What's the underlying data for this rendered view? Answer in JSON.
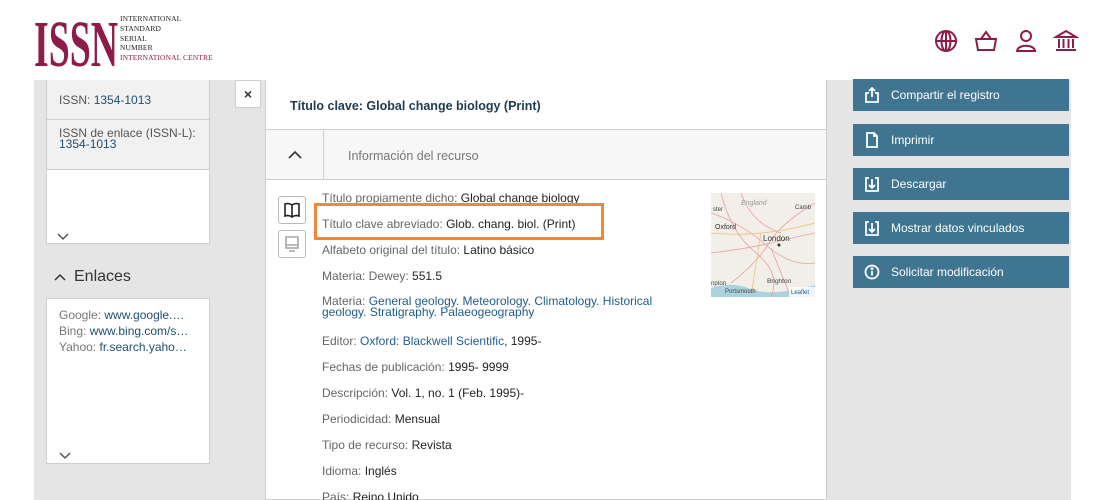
{
  "header": {
    "logo_letters": "ISSN",
    "logo_lines": [
      "INTERNATIONAL",
      "STANDARD",
      "SERIAL",
      "NUMBER",
      "INTERNATIONAL CENTRE"
    ],
    "brand_color": "#8d1c4a",
    "icons": [
      "globe-icon",
      "basket-icon",
      "user-icon",
      "institution-icon"
    ]
  },
  "left": {
    "issn_label": "ISSN: ",
    "issn_value": "1354-1013",
    "issnl_label": "ISSN de enlace (ISSN-L): ",
    "issnl_value": "1354-1013",
    "enlaces_title": "Enlaces",
    "links": [
      {
        "label": "Google: ",
        "value": "www.google.…"
      },
      {
        "label": "Bing: ",
        "value": "www.bing.com/s…"
      },
      {
        "label": "Yahoo: ",
        "value": "fr.search.yaho…"
      }
    ]
  },
  "main": {
    "close": "×",
    "key_title": "Título clave: Global change biology (Print)",
    "section_label": "Información del recurso",
    "fields": [
      {
        "label": "Título propiamente dicho: ",
        "value": "Global change biology"
      },
      {
        "label": "Título clave abreviado: ",
        "value": "Glob. chang. biol. (Print)"
      },
      {
        "label": "Alfabeto original del título: ",
        "value": "Latino básico"
      },
      {
        "label": "Materia: Dewey: ",
        "value": "551.5"
      },
      {
        "label": "Materia: ",
        "links": "General geology. Meteorology. Climatology. Historical geology. Stratigraphy. Palaeogeography"
      },
      {
        "label": "Editor: ",
        "links": "Oxford: Blackwell Scientific",
        "value": ", 1995-"
      },
      {
        "label": "Fechas de publicación: ",
        "value": "1995- 9999"
      },
      {
        "label": "Descripción: ",
        "value": "Vol. 1, no. 1 (Feb. 1995)-"
      },
      {
        "label": "Periodicidad: ",
        "value": "Mensual"
      },
      {
        "label": "Tipo de recurso: ",
        "value": "Revista"
      },
      {
        "label": "Idioma: ",
        "value": "Inglés"
      },
      {
        "label": "País: ",
        "value": "Reino Unido"
      }
    ],
    "map": {
      "england": "England",
      "oxford": "Oxford",
      "london": "London",
      "brighton": "Brighton",
      "portsmouth": "Portsmouth",
      "pton": "npton",
      "ster": "ster",
      "camb": "Camb",
      "leaflet": "Leaflet"
    }
  },
  "right": {
    "buttons": [
      {
        "label": "Compartir el registro",
        "icon": "share-icon"
      },
      {
        "label": "Imprimir",
        "icon": "print-icon"
      },
      {
        "label": "Descargar",
        "icon": "download-icon"
      },
      {
        "label": "Mostrar datos vinculados",
        "icon": "linked-data-icon"
      },
      {
        "label": "Solicitar modificación",
        "icon": "info-icon"
      }
    ],
    "button_color": "#3f7591"
  },
  "colors": {
    "highlight": "#f0883a",
    "link": "#1f5e87"
  }
}
